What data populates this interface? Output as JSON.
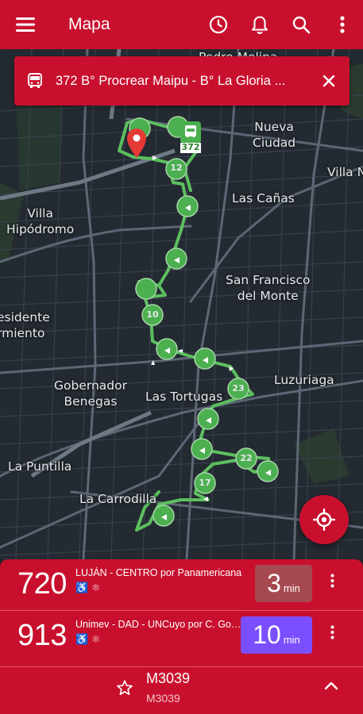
{
  "appbar": {
    "title": "Mapa",
    "icons": [
      "menu-icon",
      "history-icon",
      "bell-icon",
      "search-icon",
      "more-vert-icon"
    ],
    "color": "#c8102e"
  },
  "route_banner": {
    "text": "372 B° Procrear Maipu - B° La Gloria ...",
    "badge": "372",
    "route_color": "#4caf50"
  },
  "map": {
    "places": [
      {
        "id": "pedro-molina",
        "text": "Pedro Molina"
      },
      {
        "id": "nueva-ciudad",
        "text": "Nueva\nCiudad"
      },
      {
        "id": "villa-nueva",
        "text": "Villa Nu"
      },
      {
        "id": "las-canas",
        "text": "Las Cañas"
      },
      {
        "id": "villa-hipodromo",
        "text": "Villa\nHipódromo"
      },
      {
        "id": "san-francisco",
        "text": "San Francisco\ndel Monte"
      },
      {
        "id": "presidente",
        "text": "esidente\nrmiento"
      },
      {
        "id": "luzuriaga",
        "text": "Luzuriaga"
      },
      {
        "id": "gobernador",
        "text": "Gobernador\nBenegas"
      },
      {
        "id": "las-tortugas",
        "text": "Las Tortugas"
      },
      {
        "id": "la-puntilla",
        "text": "La Puntilla"
      },
      {
        "id": "la-carrodilla",
        "text": "La Carrodilla"
      }
    ],
    "stop_numbers": [
      "12",
      "10",
      "23",
      "22",
      "17"
    ]
  },
  "arrivals": [
    {
      "line": "720",
      "destination": "LUJÁN - CENTRO por Panamericana",
      "eta": "3",
      "unit": "min",
      "type": "realtime"
    },
    {
      "line": "913",
      "destination": "Unimev - DAD - UNCuyo por C. Godoy Cruz",
      "eta": "10",
      "unit": "min",
      "type": "scheduled"
    }
  ],
  "stop": {
    "code": "M3039",
    "subtitle": "M3039"
  }
}
